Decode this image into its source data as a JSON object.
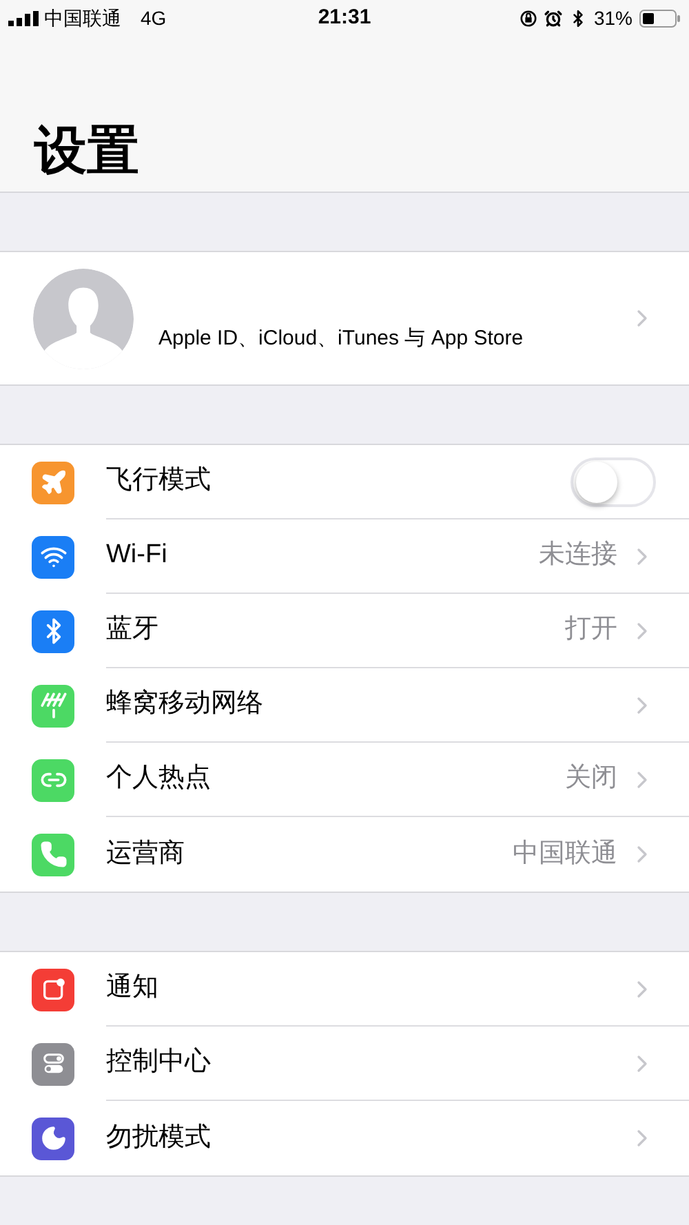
{
  "status_bar": {
    "carrier": "中国联通",
    "network": "4G",
    "time": "21:31",
    "battery": "31%"
  },
  "title": "设置",
  "profile": {
    "subtitle": "Apple ID、iCloud、iTunes 与 App Store"
  },
  "sections": [
    {
      "rows": [
        {
          "kind": "toggle",
          "label": "飞行模式",
          "color": "#f7952f",
          "on": false
        },
        {
          "kind": "link",
          "label": "Wi-Fi",
          "color": "#1a7ef5",
          "value": "未连接"
        },
        {
          "kind": "link",
          "label": "蓝牙",
          "color": "#1a7ef5",
          "value": "打开"
        },
        {
          "kind": "link",
          "label": "蜂窝移动网络",
          "color": "#4cd964"
        },
        {
          "kind": "link",
          "label": "个人热点",
          "color": "#4cd964",
          "value": "关闭"
        },
        {
          "kind": "link",
          "label": "运营商",
          "color": "#4cd964",
          "value": "中国联通"
        }
      ]
    },
    {
      "rows": [
        {
          "kind": "link",
          "label": "通知",
          "color": "#f43d36"
        },
        {
          "kind": "link",
          "label": "控制中心",
          "color": "#8e8e93"
        },
        {
          "kind": "link",
          "label": "勿扰模式",
          "color": "#5a57d6"
        }
      ]
    }
  ]
}
